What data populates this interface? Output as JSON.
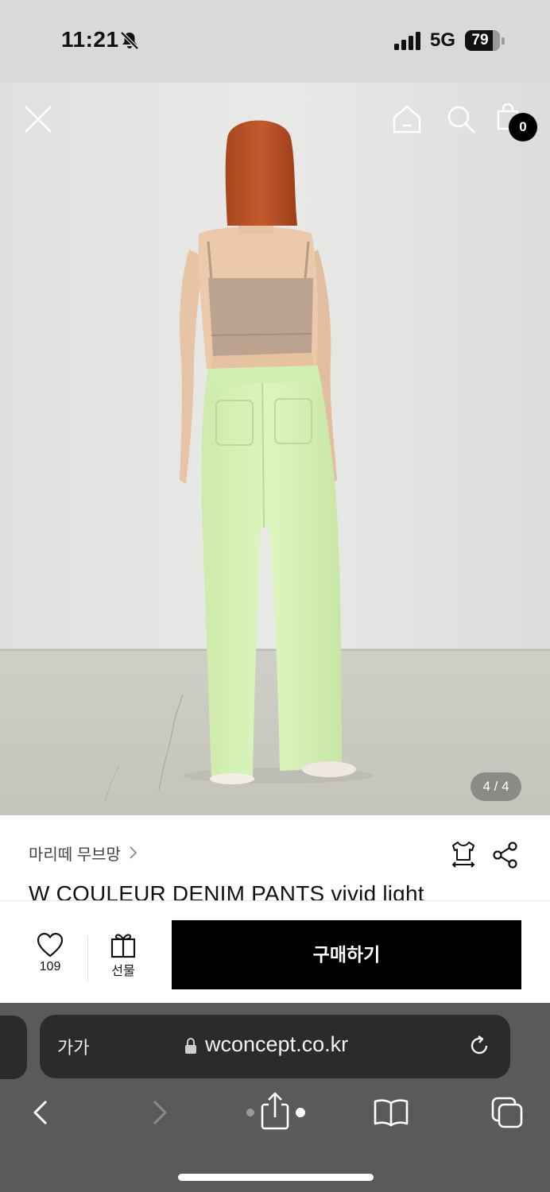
{
  "status_bar": {
    "time": "11:21",
    "network": "5G",
    "battery": "79",
    "battery_level": 0.79,
    "icons": [
      "bell-slash-icon",
      "cellular-signal-icon",
      "battery-icon"
    ]
  },
  "product_header": {
    "icons": [
      "close-icon",
      "home-icon",
      "search-icon",
      "shopping-bag-icon"
    ],
    "cart_count": "0",
    "image_indicator": "4 / 4"
  },
  "product": {
    "brand": "마리떼 무브망",
    "title": "W COULEUR DENIM PANTS vivid light",
    "icons": [
      "chevron-right-icon",
      "size-fit-icon",
      "share-icon"
    ]
  },
  "purchase_bar": {
    "like_count": "109",
    "gift_label": "선물",
    "buy_label": "구매하기",
    "icons": [
      "heart-icon",
      "gift-icon"
    ]
  },
  "browser": {
    "text_size_label": "가가",
    "url": "wconcept.co.kr",
    "icons": [
      "lock-icon",
      "reload-icon",
      "back-icon",
      "forward-icon",
      "share-icon",
      "bookmarks-icon",
      "tabs-icon"
    ]
  },
  "colors": {
    "primary": "#000000",
    "status_bar_bg": "#d9d9d9",
    "browser_bg": "#5a5a5a",
    "url_bar_bg": "#2b2b2b",
    "pants": "#d4f0b0",
    "top": "#bba18d"
  }
}
